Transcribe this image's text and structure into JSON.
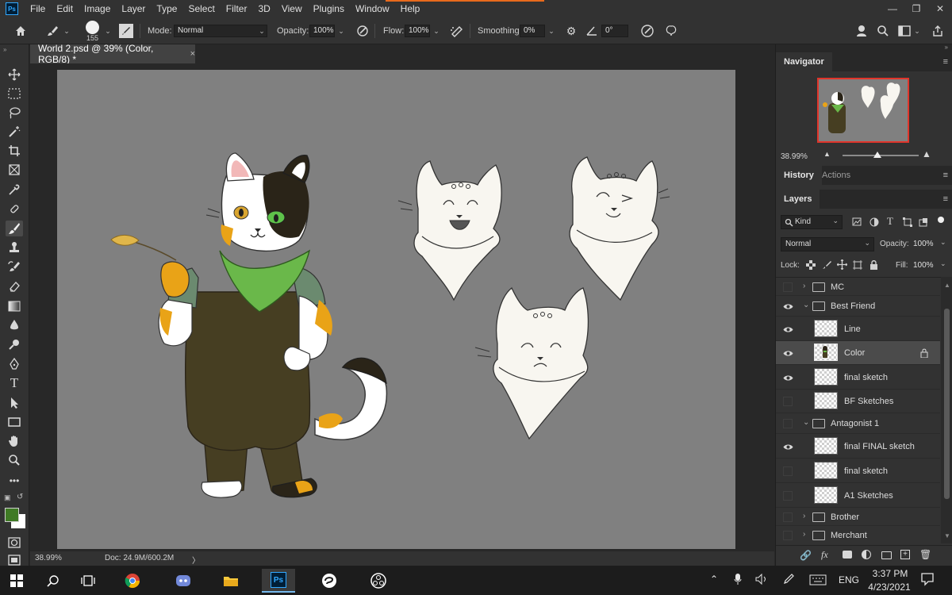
{
  "app": {
    "logo": "Ps",
    "menu": [
      "File",
      "Edit",
      "Image",
      "Layer",
      "Type",
      "Select",
      "Filter",
      "3D",
      "View",
      "Plugins",
      "Window",
      "Help"
    ],
    "window_controls": [
      "minimize-icon",
      "restore-icon",
      "close-icon"
    ]
  },
  "options": {
    "brush_size": "155",
    "mode_label": "Mode:",
    "mode_value": "Normal",
    "opacity_label": "Opacity:",
    "opacity_value": "100%",
    "flow_label": "Flow:",
    "flow_value": "100%",
    "smoothing_label": "Smoothing:",
    "smoothing_value": "0%",
    "angle_value": "0°"
  },
  "document": {
    "tab_title": "World 2.psd @ 39% (Color, RGB/8) *",
    "close_glyph": "×"
  },
  "status": {
    "zoom": "38.99%",
    "doc_info": "Doc: 24.9M/600.2M",
    "arrow": "〉"
  },
  "navigator": {
    "title": "Navigator",
    "zoom": "38.99%"
  },
  "history_panel": {
    "tabs": [
      "History",
      "Actions"
    ]
  },
  "layers_panel": {
    "title": "Layers",
    "filter_label": "Kind",
    "blend_mode": "Normal",
    "opacity_label": "Opacity:",
    "opacity_value": "100%",
    "lock_label": "Lock:",
    "fill_label": "Fill:",
    "fill_value": "100%",
    "layers": [
      {
        "name": "MC",
        "type": "group",
        "visible": false,
        "expanded": false,
        "indent": 0
      },
      {
        "name": "Best Friend",
        "type": "group",
        "visible": true,
        "expanded": true,
        "indent": 0
      },
      {
        "name": "Line",
        "type": "layer",
        "visible": true,
        "indent": 1
      },
      {
        "name": "Color",
        "type": "layer",
        "visible": true,
        "indent": 1,
        "selected": true,
        "locked": true
      },
      {
        "name": "final sketch",
        "type": "layer",
        "visible": true,
        "indent": 1
      },
      {
        "name": "BF Sketches",
        "type": "layer",
        "visible": false,
        "indent": 1
      },
      {
        "name": "Antagonist 1",
        "type": "group",
        "visible": false,
        "expanded": true,
        "indent": 0
      },
      {
        "name": "final FINAL sketch",
        "type": "layer",
        "visible": true,
        "indent": 1
      },
      {
        "name": "final sketch",
        "type": "layer",
        "visible": false,
        "indent": 1
      },
      {
        "name": "A1 Sketches",
        "type": "layer",
        "visible": false,
        "indent": 1
      },
      {
        "name": "Brother",
        "type": "group",
        "visible": false,
        "expanded": false,
        "indent": 0
      },
      {
        "name": "Merchant",
        "type": "group",
        "visible": false,
        "expanded": false,
        "indent": 0
      }
    ],
    "footer_icons": [
      "link-icon",
      "fx-icon",
      "mask-icon",
      "adjustment-icon",
      "group-icon",
      "new-layer-icon",
      "trash-icon"
    ]
  },
  "taskbar": {
    "time": "3:37 PM",
    "date": "4/23/2021",
    "language": "ENG"
  },
  "colors": {
    "foreground": "#3f7a25",
    "background": "#ffffff",
    "accent": "#31a8ff"
  }
}
